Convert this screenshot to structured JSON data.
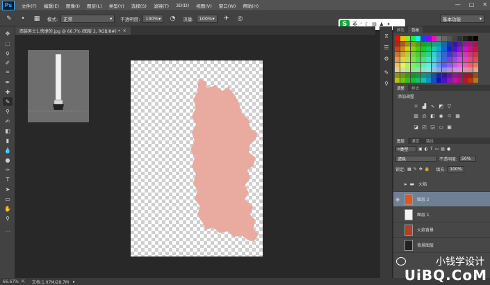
{
  "menubar": {
    "logo": "Ps",
    "items": [
      "文件(F)",
      "编辑(E)",
      "图像(I)",
      "图层(L)",
      "类型(Y)",
      "选择(S)",
      "滤镜(T)",
      "3D(D)",
      "视图(V)",
      "窗口(W)",
      "帮助(H)"
    ],
    "window_controls": [
      "—",
      "□",
      "✕"
    ]
  },
  "options": {
    "mode_label": "模式:",
    "mode_value": "正常",
    "opacity_label": "不透明度:",
    "opacity_value": "100%",
    "flow_label": "流量:",
    "flow_value": "100%",
    "workspace": "基本功能",
    "ime_label": "英"
  },
  "document": {
    "tab_title": "西装男士1.快捷的.jpg @ 66.7% (图层 2, RGB/8#) *"
  },
  "status": {
    "zoom": "66.67%",
    "doc_size": "文档:1.07M/28.7M"
  },
  "panels": {
    "color_tabs": [
      "颜色",
      "色板"
    ],
    "adjust_tabs": [
      "调整",
      "样式"
    ],
    "adjust_title": "添加调整",
    "layer_tabs": [
      "图层",
      "通道",
      "路径"
    ],
    "kind_label": "类型",
    "blend_mode": "滤色",
    "opacity_label": "不透明度:",
    "opacity_value": "50%",
    "lock_label": "锁定:",
    "fill_label": "填充:",
    "fill_value": "100%"
  },
  "layers": [
    {
      "name": "火焰",
      "type": "group",
      "visible": false,
      "selected": false
    },
    {
      "name": "图层 2",
      "type": "layer",
      "visible": true,
      "selected": true
    },
    {
      "name": "图层 1",
      "type": "layer",
      "visible": false,
      "selected": false
    },
    {
      "name": "火焰背景",
      "type": "layer",
      "visible": false,
      "selected": false
    },
    {
      "name": "背景图层",
      "type": "layer",
      "visible": false,
      "selected": false
    }
  ],
  "watermark": {
    "text": "小钱学设计",
    "site": "UiBQ.CoM"
  },
  "colors": {
    "foreground": "#e2561e",
    "background": "#ffffff",
    "shape_fill": "#e9aaa0",
    "selected_layer": "#6f7f94"
  }
}
